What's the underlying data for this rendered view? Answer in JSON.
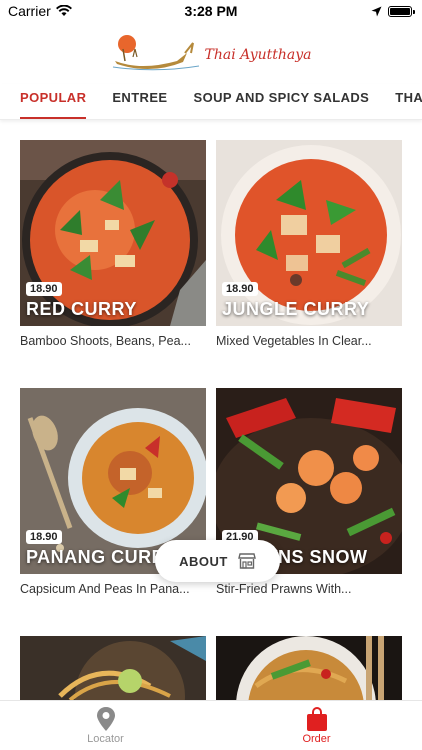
{
  "status_bar": {
    "carrier": "Carrier",
    "time": "3:28 PM"
  },
  "header": {
    "logo_text": "Thai Ayutthaya"
  },
  "tabs": [
    {
      "label": "POPULAR",
      "active": true
    },
    {
      "label": "ENTREE",
      "active": false
    },
    {
      "label": "SOUP AND SPICY SALADS",
      "active": false
    },
    {
      "label": "THAI CU",
      "active": false
    }
  ],
  "menu_items": [
    {
      "name": "RED CURRY",
      "price": "18.90",
      "description": "Bamboo Shoots, Beans, Pea..."
    },
    {
      "name": "JUNGLE CURRY",
      "price": "18.90",
      "description": "Mixed Vegetables In Clear..."
    },
    {
      "name": "PANANG CURRY",
      "price": "18.90",
      "description": "Capsicum And Peas In Pana..."
    },
    {
      "name": "PRAWNS SNOW",
      "price": "21.90",
      "description": "Stir-Fried Prawns With..."
    }
  ],
  "about_button": {
    "label": "ABOUT",
    "icon": "store-icon"
  },
  "bottom_nav": [
    {
      "label": "Locator",
      "icon": "location-pin-icon",
      "active": false
    },
    {
      "label": "Order",
      "icon": "shopping-bag-icon",
      "active": true
    }
  ],
  "colors": {
    "accent": "#c8302a",
    "order_active": "#e02020"
  }
}
